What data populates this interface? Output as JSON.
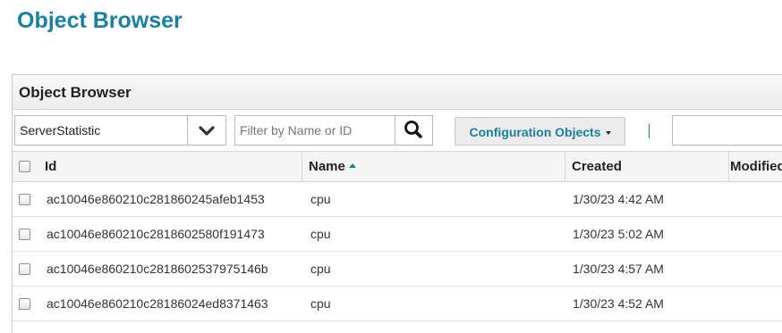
{
  "page": {
    "title": "Object Browser"
  },
  "panel": {
    "title": "Object Browser"
  },
  "toolbar": {
    "type_select_value": "ServerStatistic",
    "filter_placeholder": "Filter by Name or ID",
    "config_button_label": "Configuration Objects"
  },
  "table": {
    "columns": {
      "id": "Id",
      "name": "Name",
      "created": "Created",
      "modified": "Modified"
    },
    "sort": {
      "column": "Name",
      "direction": "ascending"
    },
    "rows": [
      {
        "id": "ac10046e860210c281860245afeb1453",
        "name": "cpu",
        "created": "1/30/23 4:42 AM"
      },
      {
        "id": "ac10046e860210c2818602580f191473",
        "name": "cpu",
        "created": "1/30/23 5:02 AM"
      },
      {
        "id": "ac10046e860210c2818602537975146b",
        "name": "cpu",
        "created": "1/30/23 4:57 AM"
      },
      {
        "id": "ac10046e860210c28186024ed8371463",
        "name": "cpu",
        "created": "1/30/23 4:52 AM"
      }
    ]
  },
  "colors": {
    "accent": "#1a7fa1",
    "header_bg": "#f5f5f5"
  },
  "icons": {
    "select_toggle": "chevron-down-icon",
    "search": "search-icon",
    "dropdown": "caret-down-icon",
    "sort": "sort-ascending-icon"
  }
}
